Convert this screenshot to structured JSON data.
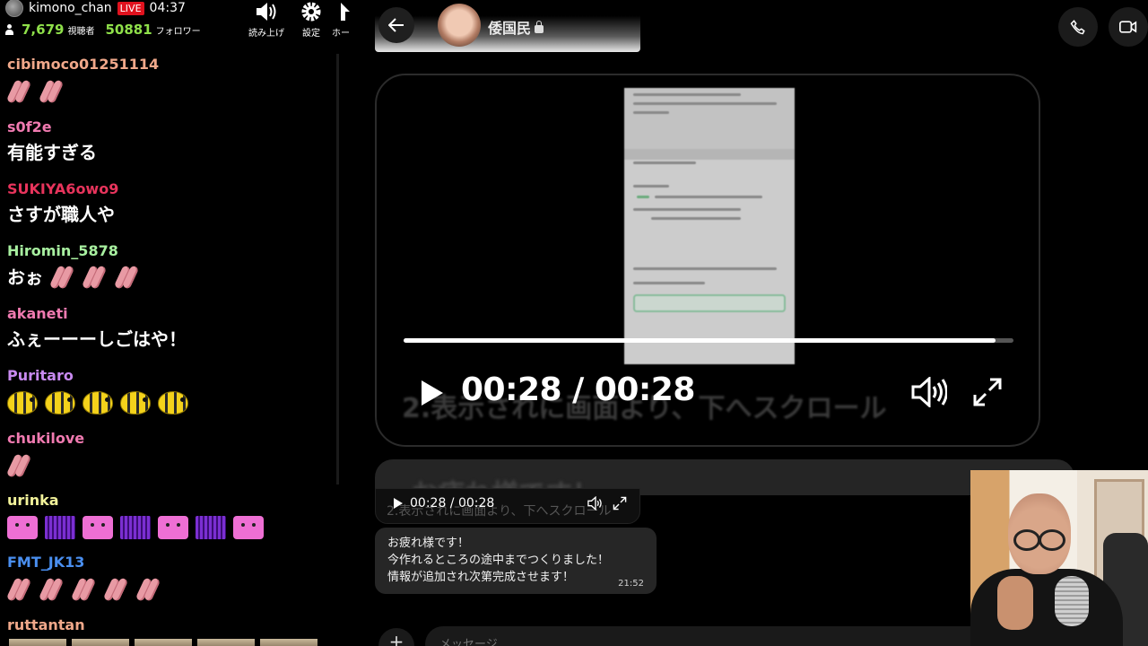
{
  "stream": {
    "channel_name": "kimono_chan",
    "live_label": "LIVE",
    "elapsed_time": "04:37",
    "viewers_count": "7,679",
    "viewers_label": "視聴者",
    "followers_count": "50881",
    "followers_label": "フォロワー",
    "tools": [
      {
        "icon": "speaker-icon",
        "label": "読み上げ"
      },
      {
        "icon": "gear-icon",
        "label": "設定"
      },
      {
        "icon": "home-icon",
        "label": "ホー"
      }
    ]
  },
  "chat": [
    {
      "user": "cibimoco01251114",
      "color": "#f0a88a",
      "text": "",
      "emotes": [
        "hand",
        "hand"
      ]
    },
    {
      "user": "s0f2e",
      "color": "#f07ab0",
      "text": "有能すぎる",
      "emotes": []
    },
    {
      "user": "SUKIYA6owo9",
      "color": "#e8345c",
      "text": "さすが職人や",
      "emotes": []
    },
    {
      "user": "Hiromin_5878",
      "color": "#a8f0a0",
      "text": "おぉ",
      "emotes": [
        "hand",
        "hand",
        "hand"
      ]
    },
    {
      "user": "akaneti",
      "color": "#f07ab0",
      "text": "ふぇーーーしごはや！",
      "emotes": []
    },
    {
      "user": "Puritaro",
      "color": "#c88af0",
      "text": "",
      "emotes": [
        "bee",
        "bee",
        "bee",
        "bee",
        "bee"
      ]
    },
    {
      "user": "chukilove",
      "color": "#f07ab0",
      "text": "",
      "emotes": [
        "hand"
      ]
    },
    {
      "user": "urinka",
      "color": "#f2f29a",
      "text": "",
      "emotes": [
        "pink",
        "bars",
        "pink",
        "bars",
        "pink",
        "bars",
        "pink"
      ]
    },
    {
      "user": "FMT_JK13",
      "color": "#4a8ff0",
      "text": "",
      "emotes": [
        "hand",
        "hand",
        "hand",
        "hand",
        "hand"
      ]
    },
    {
      "user": "ruttantan",
      "color": "#f0a88a",
      "text": "",
      "emotes": []
    }
  ],
  "dm": {
    "contact_name": "倭国民",
    "big_video": {
      "current_time": "00:28",
      "separator": " / ",
      "total_time": "00:28",
      "progress": 0.97,
      "caption_ghost": "2.表示されに画面より、下へスクロール"
    },
    "blurred_text": "お疲れ様です！",
    "small_video": {
      "time_text": "00:28 / 00:28",
      "caption_ghost": "2.表示されに画面より、下へスクロール"
    },
    "message": {
      "lines": [
        "お疲れ様です！",
        "今作れるところの途中までつくりました！",
        "情報が追加され次第完成させます！"
      ],
      "time": "21:52"
    },
    "compose_placeholder": "メッセージ"
  }
}
